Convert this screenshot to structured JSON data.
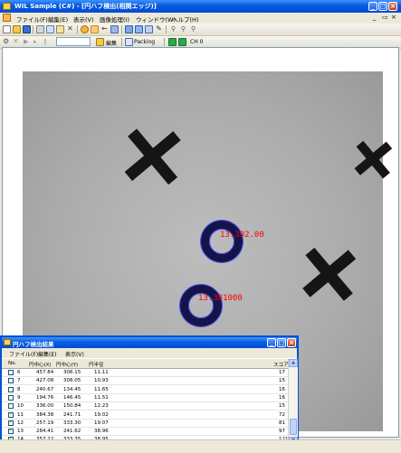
{
  "window": {
    "title": "WIL Sample (C#) - [円ハフ検出(相関エッジ)]"
  },
  "menubar": {
    "items": [
      "ファイル(F)",
      "編集(E)",
      "表示(V)",
      "画像処理(I)",
      "ウィンドウ(W)",
      "ヘルプ(H)"
    ]
  },
  "toolbar2": {
    "edit_label": "編集",
    "packing_label": "Packing",
    "channel_label": "CH 0"
  },
  "image": {
    "label_1": "13.392.00",
    "label_2": "13.381000"
  },
  "result_window": {
    "title": "円ハフ検出結果",
    "menu": [
      "ファイル(F)",
      "編集(E)",
      "表示(V)"
    ],
    "columns": [
      "No.",
      "円中心(X)",
      "円中心(Y)",
      "円半径",
      "スコア"
    ],
    "rows": [
      {
        "no": "6",
        "x": "457.84",
        "y": "306.15",
        "r": "11.11",
        "score": "17",
        "checked": false
      },
      {
        "no": "7",
        "x": "427.08",
        "y": "308.05",
        "r": "10.93",
        "score": "15",
        "checked": false
      },
      {
        "no": "8",
        "x": "240.67",
        "y": "134.45",
        "r": "11.65",
        "score": "16",
        "checked": false
      },
      {
        "no": "9",
        "x": "194.76",
        "y": "146.45",
        "r": "11.51",
        "score": "16",
        "checked": false
      },
      {
        "no": "10",
        "x": "336.00",
        "y": "150.84",
        "r": "12.23",
        "score": "15",
        "checked": false
      },
      {
        "no": "11",
        "x": "384.38",
        "y": "241.71",
        "r": "19.02",
        "score": "72",
        "checked": true
      },
      {
        "no": "12",
        "x": "257.19",
        "y": "333.30",
        "r": "19.07",
        "score": "81",
        "checked": true
      },
      {
        "no": "13",
        "x": "284.41",
        "y": "241.62",
        "r": "38.96",
        "score": "97",
        "checked": true
      },
      {
        "no": "14",
        "x": "357.22",
        "y": "333.35",
        "r": "38.95",
        "score": "121",
        "checked": true
      }
    ]
  },
  "colors": {
    "titlebar": "#0a5ddf",
    "ring": "#1a1a6e",
    "ring_outline": "#4040ff",
    "label": "#ff0000"
  }
}
